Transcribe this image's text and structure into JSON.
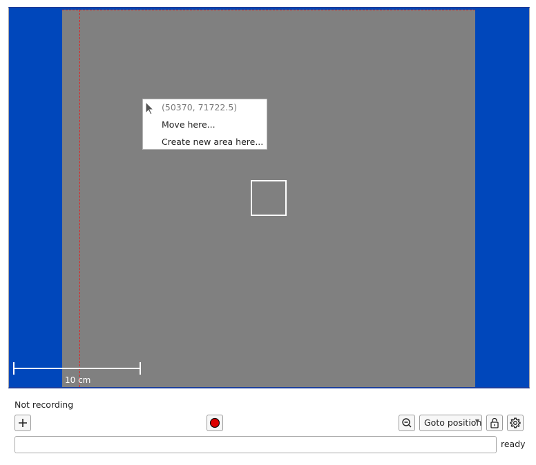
{
  "map": {
    "colors": {
      "background": "#0047bb",
      "stage_area": "#808080",
      "guide": "#e02020",
      "marker": "#ffffff"
    },
    "scale_label": "10 cm"
  },
  "context_menu": {
    "cursor_icon": "arrow-cursor-icon",
    "coordinates": "(50370, 71722.5)",
    "items": [
      {
        "label": "Move here..."
      },
      {
        "label": "Create new area here..."
      }
    ]
  },
  "status": {
    "recording": "Not recording",
    "ready": "ready"
  },
  "toolbar": {
    "add_icon": "plus-icon",
    "record_icon": "record-icon",
    "record_color": "#dd0000",
    "zoom_icon": "zoom-out-icon",
    "goto_label": "Goto position",
    "lock_icon": "lock-open-icon",
    "settings_icon": "gear-icon"
  },
  "command": {
    "value": "",
    "placeholder": ""
  }
}
